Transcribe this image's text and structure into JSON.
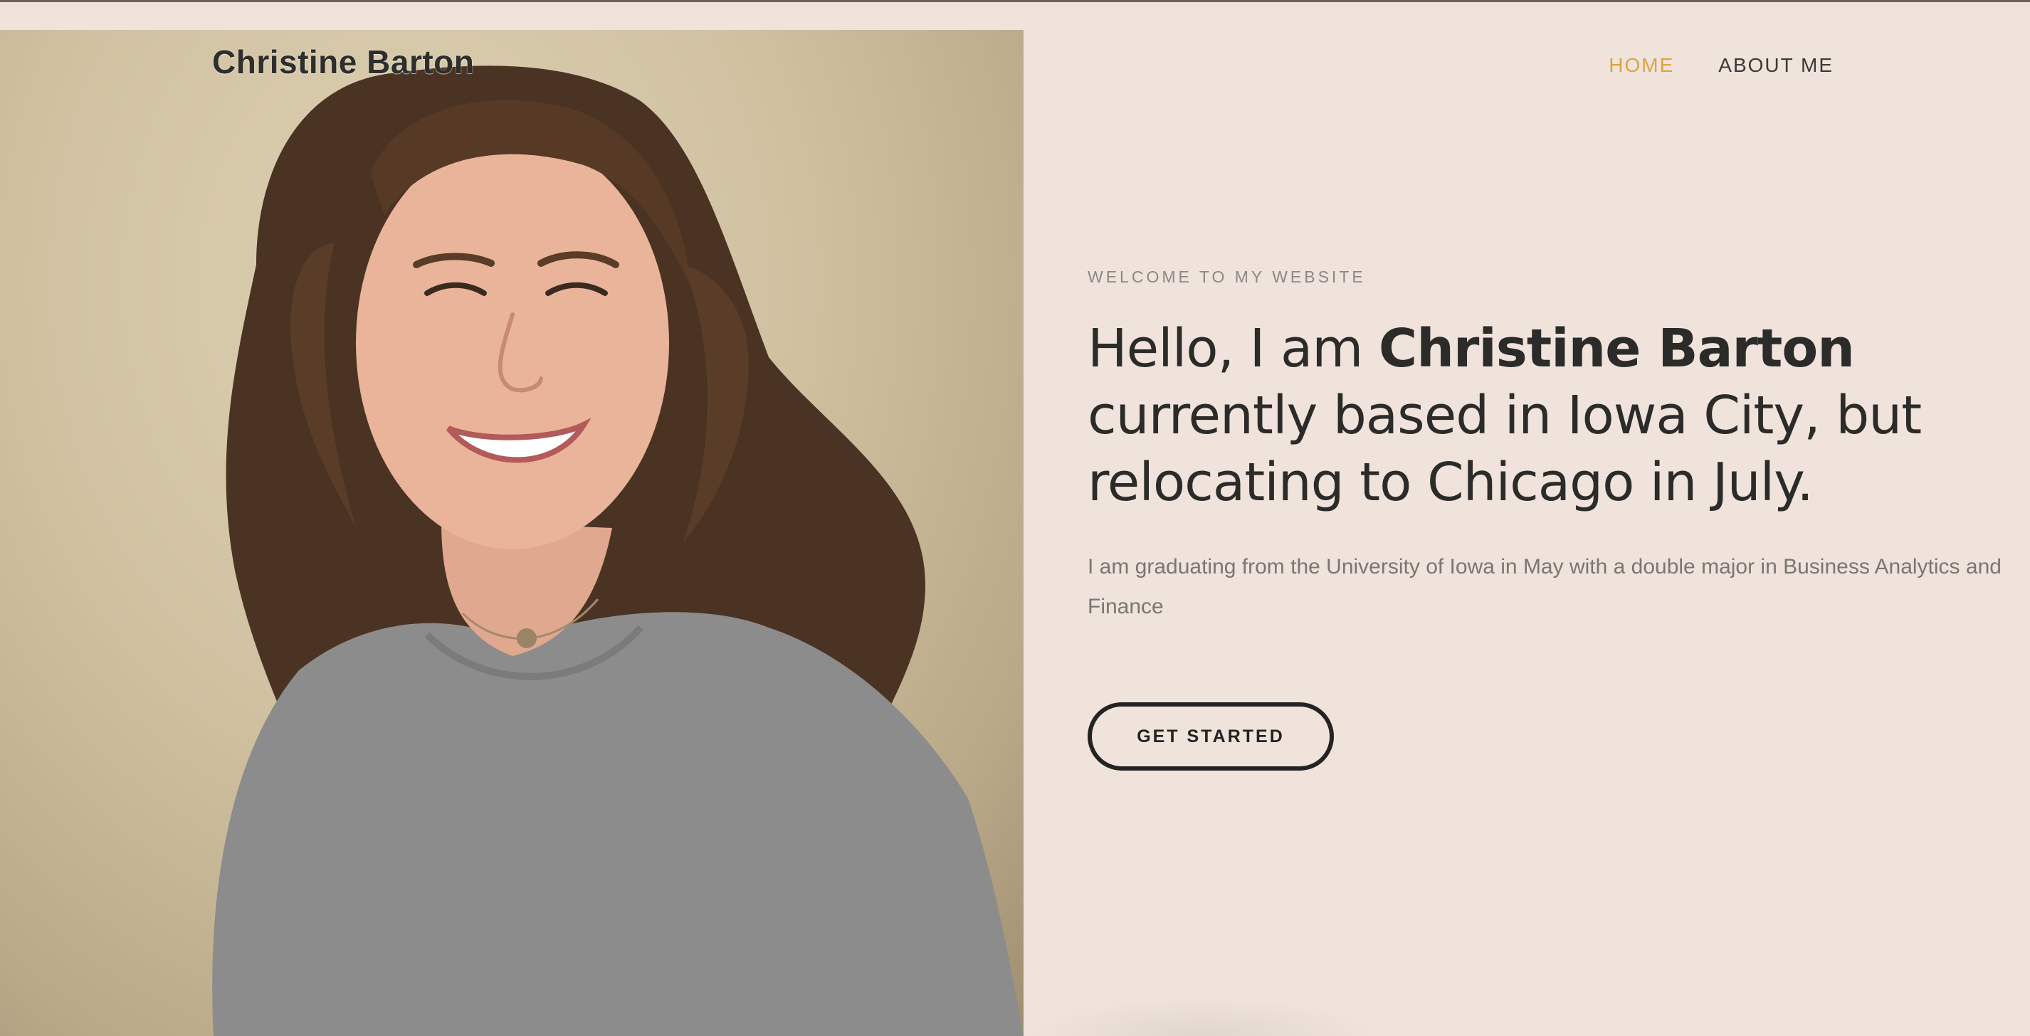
{
  "brand": {
    "name": "Christine Barton"
  },
  "nav": {
    "items": [
      {
        "label": "HOME",
        "active": true
      },
      {
        "label": "ABOUT ME",
        "active": false
      }
    ]
  },
  "hero": {
    "eyebrow": "WELCOME TO MY WEBSITE",
    "headline_pre": "Hello, I am ",
    "headline_name": "Christine Barton",
    "headline_post": " currently based in Iowa City, but relocating to Chicago in July.",
    "subtext": "I am graduating from the University of Iowa in May with a double major in Business Analytics and Finance",
    "cta_label": "GET STARTED"
  },
  "colors": {
    "background": "#efe3db",
    "accent": "#d9a441",
    "text_dark": "#2b2b2a",
    "text_muted": "#7a7673"
  },
  "icons": {
    "photo": "portrait-photo"
  }
}
